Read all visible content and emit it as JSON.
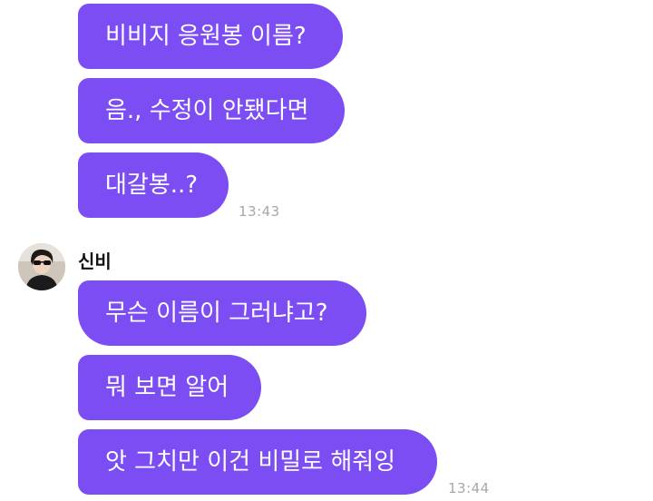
{
  "group1": {
    "messages": [
      {
        "text": "비비지 응원봉 이름?"
      },
      {
        "text": "음., 수정이 안됐다면"
      },
      {
        "text": "대갈봉..?"
      }
    ],
    "time": "13:43"
  },
  "group2": {
    "sender": "신비",
    "messages": [
      {
        "text": "무슨 이름이 그러냐고?"
      },
      {
        "text": "뭐 보면 알어"
      },
      {
        "text": "앗 그치만 이건 비밀로 해줘잉"
      }
    ],
    "time": "13:44"
  },
  "colors": {
    "bubble": "#7b4df2",
    "bubble_text": "#ffffff",
    "timestamp": "#a7a7ab"
  }
}
